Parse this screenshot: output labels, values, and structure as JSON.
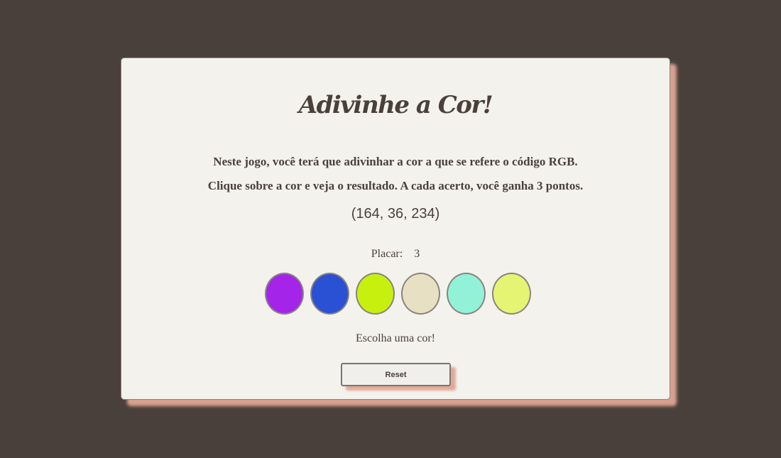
{
  "game": {
    "title": "Adivinhe a Cor!",
    "instruction_line1": "Neste jogo, você terá que adivinhar a cor a que se refere o código RGB.",
    "instruction_line2": "Clique sobre a cor e veja o resultado. A cada acerto, você ganha 3 pontos.",
    "rgb_code": "(164, 36, 234)",
    "score_label": "Placar:",
    "score_value": "3",
    "message": "Escolha uma cor!",
    "reset_label": "Reset"
  },
  "swatches": [
    {
      "color": "#a424ea"
    },
    {
      "color": "#2a50d4"
    },
    {
      "color": "#c8f00f"
    },
    {
      "color": "#e8e0c2"
    },
    {
      "color": "#92f2d8"
    },
    {
      "color": "#e6f474"
    }
  ],
  "colors": {
    "background": "#4a403b",
    "card": "#f3f2ed",
    "shadow": "#dfa594",
    "text": "#4a403b"
  }
}
